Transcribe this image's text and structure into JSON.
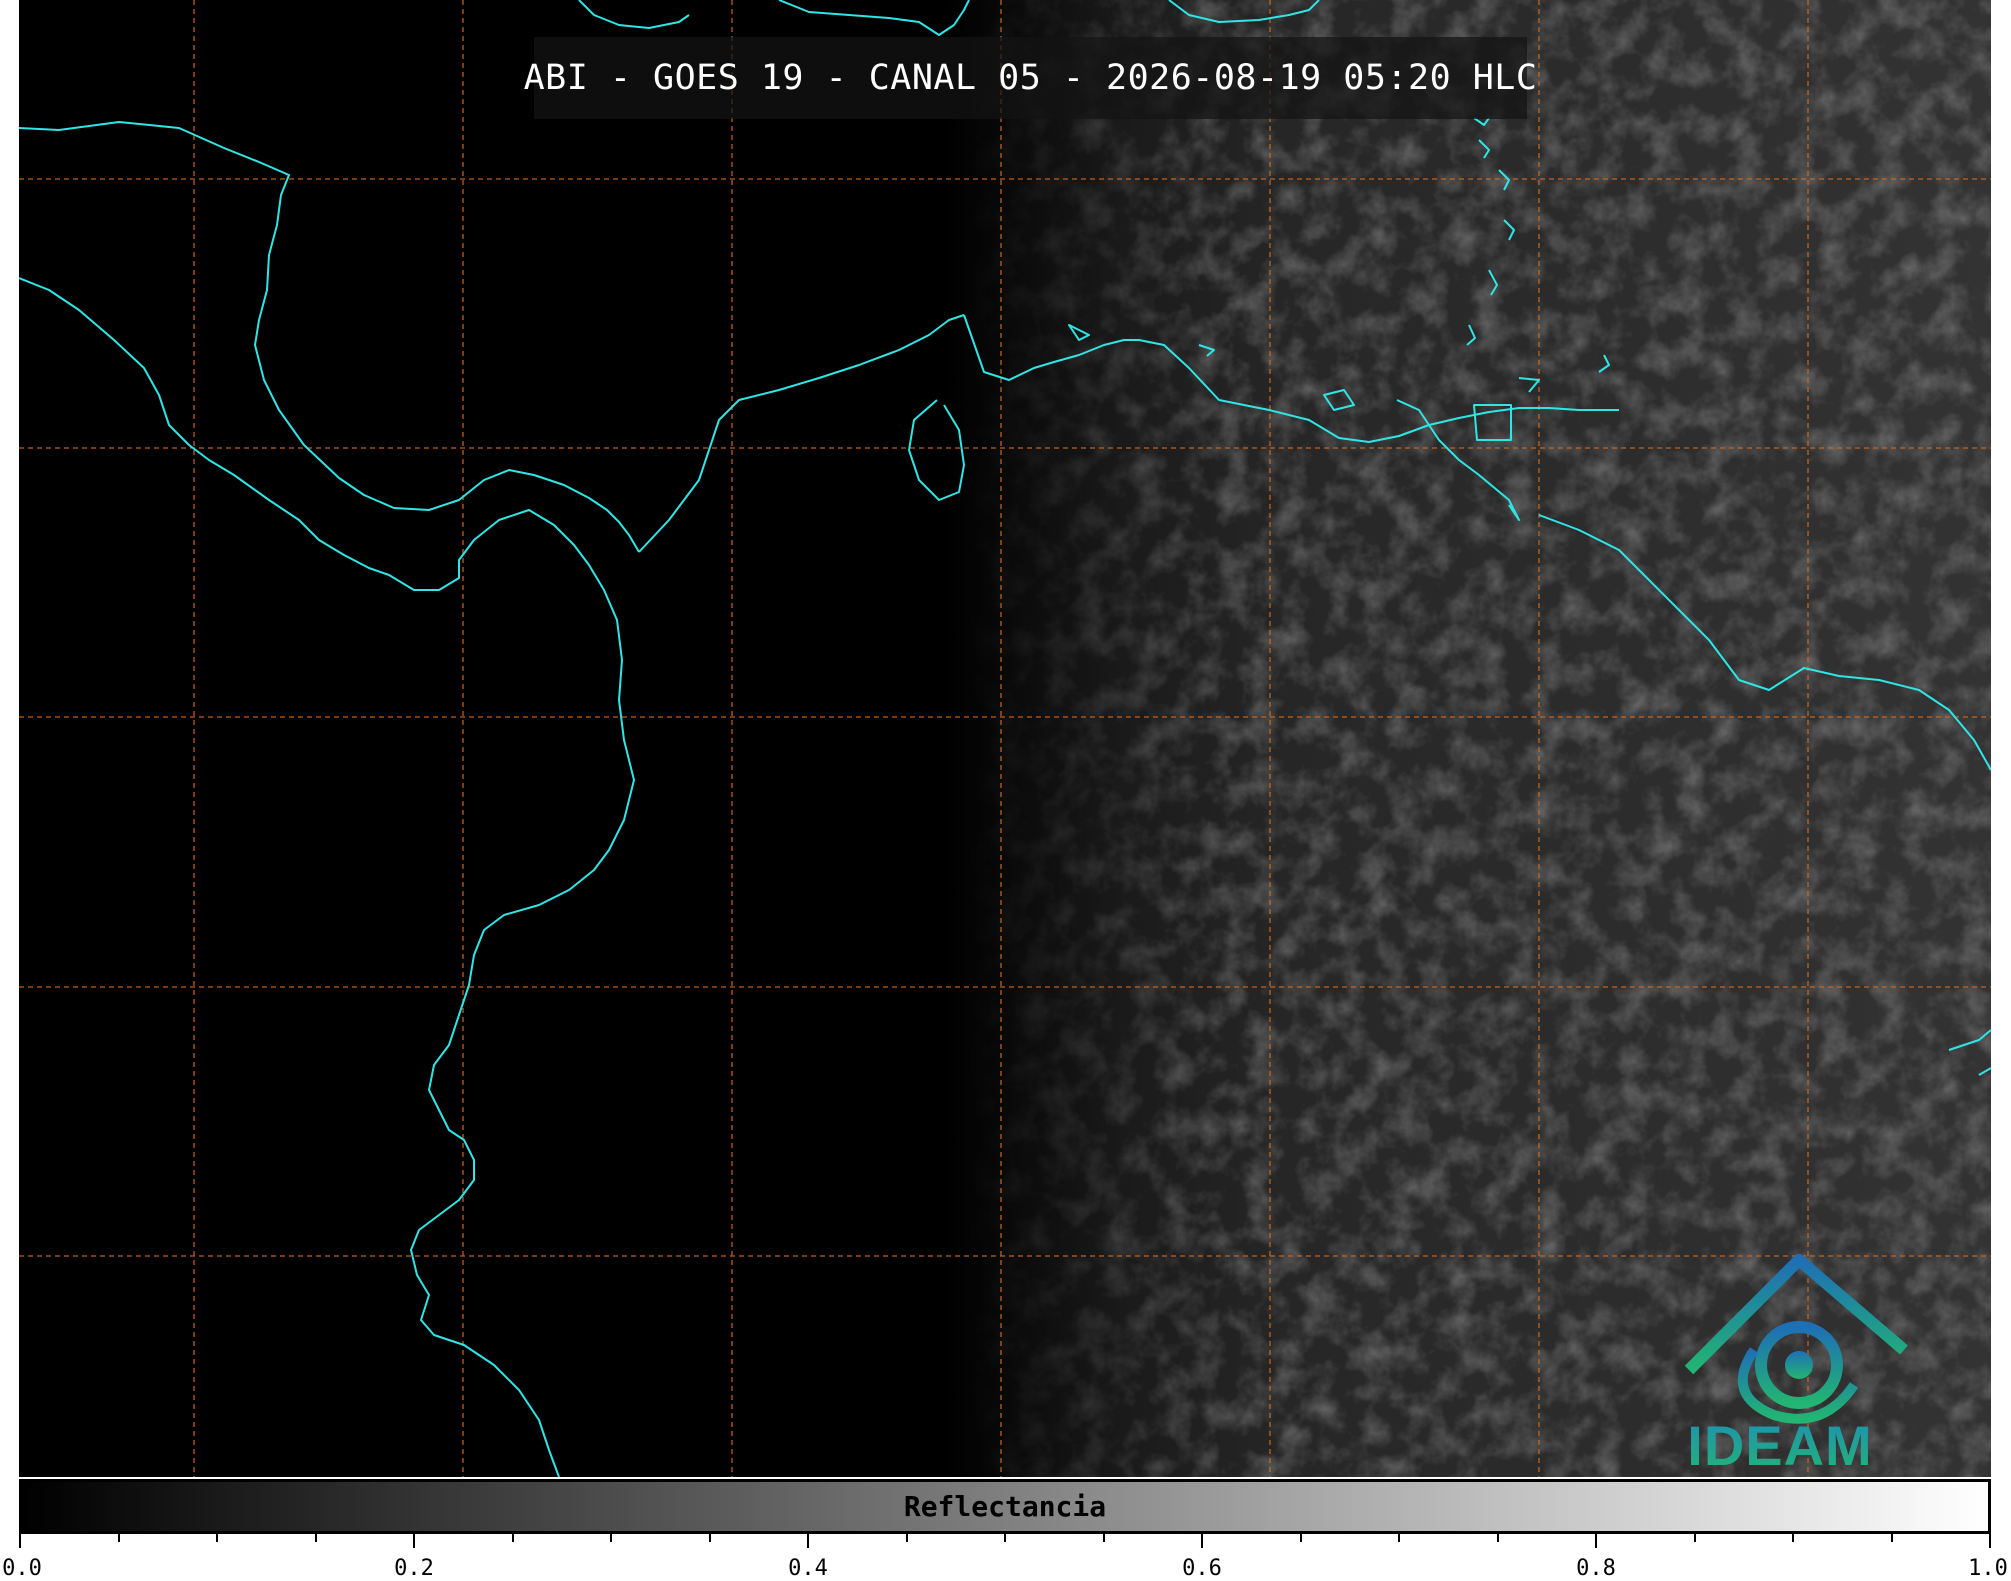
{
  "title": "ABI - GOES 19 - CANAL 05 - 2026-08-19 05:20 HLC",
  "colorbar": {
    "label": "Reflectancia",
    "ticks": [
      "0.0",
      "0.2",
      "0.4",
      "0.6",
      "0.8",
      "1.0"
    ],
    "range": [
      0.0,
      1.0
    ],
    "colormap": [
      "#000000",
      "#ffffff"
    ]
  },
  "map": {
    "coastline_color": "#2fe6e6",
    "grid_color": "#d2691e",
    "grid_style": "dashed",
    "background": "#000000"
  },
  "logo": {
    "text": "IDEAM",
    "colors": [
      "#1e6fb5",
      "#22b573"
    ]
  }
}
